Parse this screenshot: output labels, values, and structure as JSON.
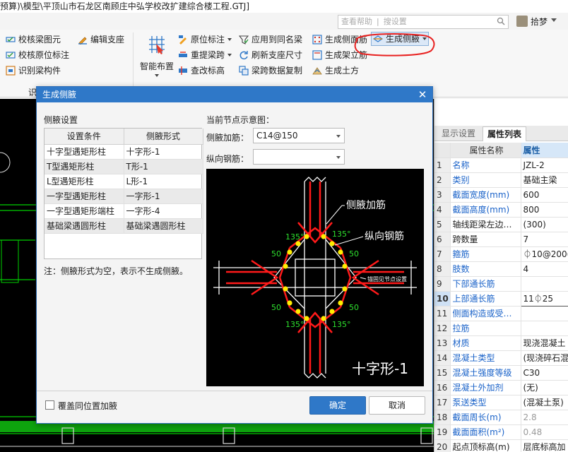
{
  "title_bar": {
    "path_text": "预算)\\模型\\平顶山市石龙区南顾庄中弘学校改扩建综合楼工程.GTJ]"
  },
  "search": {
    "placeholder_left": "查看帮助",
    "placeholder_right": "搜设置"
  },
  "user": {
    "name": "拾梦"
  },
  "ribbon": {
    "col1": [
      "校核梁图元",
      "校核原位标注",
      "识别梁构件"
    ],
    "col2": [
      "编辑支座"
    ],
    "smart_layout": "智能布置",
    "col3": [
      "原位标注",
      "重提梁跨",
      "查改标高"
    ],
    "col4": [
      "应用到同名梁",
      "刷新支座尺寸",
      "梁跨数据复制"
    ],
    "col5": [
      "生成侧面筋",
      "生成架立筋",
      "生成土方"
    ],
    "active": "生成侧腋",
    "group_label": "识"
  },
  "property_panel": {
    "tabs": [
      "显示设置",
      "属性列表"
    ],
    "header": {
      "name": "属性名称",
      "value": "属性"
    },
    "rows": [
      {
        "num": "1",
        "label": "名称",
        "value": "JZL-2",
        "blue": true
      },
      {
        "num": "2",
        "label": "类别",
        "value": "基础主梁",
        "blue": true
      },
      {
        "num": "3",
        "label": "截面宽度(mm)",
        "value": "600",
        "blue": true
      },
      {
        "num": "4",
        "label": "截面高度(mm)",
        "value": "800",
        "blue": true
      },
      {
        "num": "5",
        "label": "轴线距梁左边…",
        "value": "(300)",
        "blue": false
      },
      {
        "num": "6",
        "label": "跨数量",
        "value": "7",
        "blue": false
      },
      {
        "num": "7",
        "label": "箍筋",
        "value": "⏀10@200(",
        "blue": true
      },
      {
        "num": "8",
        "label": "肢数",
        "value": "4",
        "blue": true
      },
      {
        "num": "9",
        "label": "下部通长筋",
        "value": "",
        "blue": true
      },
      {
        "num": "10",
        "label": "上部通长筋",
        "value": "11⏀25",
        "blue": true,
        "active": true
      },
      {
        "num": "11",
        "label": "侧面构造或受…",
        "value": "",
        "blue": true
      },
      {
        "num": "12",
        "label": "拉筋",
        "value": "",
        "blue": true
      },
      {
        "num": "13",
        "label": "材质",
        "value": "现浇混凝土",
        "blue": true
      },
      {
        "num": "14",
        "label": "混凝土类型",
        "value": "(现浇碎石混",
        "blue": true
      },
      {
        "num": "15",
        "label": "混凝土强度等级",
        "value": "C30",
        "blue": true
      },
      {
        "num": "16",
        "label": "混凝土外加剂",
        "value": "(无)",
        "blue": true
      },
      {
        "num": "17",
        "label": "泵送类型",
        "value": "(混凝土泵)",
        "blue": true
      },
      {
        "num": "18",
        "label": "截面周长(m)",
        "value": "2.8",
        "blue": true,
        "gray": true
      },
      {
        "num": "19",
        "label": "截面面积(m²)",
        "value": "0.48",
        "blue": true,
        "gray": true
      },
      {
        "num": "20",
        "label": "起点顶标高(m)",
        "value": "层底标高加",
        "blue": false
      }
    ]
  },
  "dialog": {
    "title": "生成侧腋",
    "section_label": "侧腋设置",
    "table_headers": [
      "设置条件",
      "侧腋形式"
    ],
    "rules": [
      {
        "condition": "十字型遇矩形柱",
        "form": "十字形-1"
      },
      {
        "condition": "T型遇矩形柱",
        "form": "T形-1"
      },
      {
        "condition": "L型遇矩形柱",
        "form": "L形-1"
      },
      {
        "condition": "一字型遇矩形柱",
        "form": "一字形-1"
      },
      {
        "condition": "一字型遇矩形端柱",
        "form": "一字形-4"
      },
      {
        "condition": "基础梁遇圆形柱",
        "form": "基础梁遇圆形柱"
      }
    ],
    "note": "注：侧腋形式为空，表示不生成侧腋。",
    "preview_label": "当前节点示意图：",
    "rib_label": "侧腋加筋：",
    "rib_value": "C14@150",
    "long_label": "纵向钢筋：",
    "long_value": "",
    "diagram": {
      "label_rib": "侧腋加筋",
      "label_long": "纵向钢筋",
      "angle": "135°",
      "dim": "50",
      "note": "锚固见节点设置",
      "caption": "十字形-1"
    },
    "override_label": "覆盖同位置加腋",
    "ok": "确定",
    "cancel": "取消"
  },
  "colors": {
    "accent": "#2f78c8",
    "cad_green": "#00e000",
    "cad_red": "#ff1a1a",
    "annotation_red": "#e8201f"
  }
}
